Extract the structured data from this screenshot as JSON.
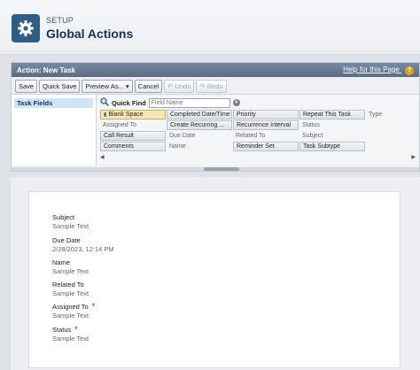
{
  "header": {
    "kicker": "SETUP",
    "title": "Global Actions",
    "icon": "gear-icon",
    "icon_bg": "#2f5d86"
  },
  "editor": {
    "title": "Action: New Task",
    "help_link": "Help for this Page",
    "help_icon": "question-icon",
    "toolbar": {
      "save": "Save",
      "quick_save": "Quick Save",
      "preview": "Preview As...",
      "cancel": "Cancel",
      "undo": "Undo",
      "redo": "Redo"
    },
    "sidebar": {
      "items": [
        "Task Fields"
      ]
    },
    "quick_find": {
      "label": "Quick Find",
      "placeholder": "Field Name"
    },
    "fields": [
      {
        "label": "Blank Space",
        "state": "selected"
      },
      {
        "label": "Completed Date/Time",
        "state": "available"
      },
      {
        "label": "Priority",
        "state": "available"
      },
      {
        "label": "Repeat This Task",
        "state": "available"
      },
      {
        "label": "Type",
        "state": "used"
      },
      {
        "label": "Assigned To",
        "state": "used"
      },
      {
        "label": "Create Recurring ...",
        "state": "available"
      },
      {
        "label": "Recurrence Interval",
        "state": "available"
      },
      {
        "label": "Status",
        "state": "used"
      },
      {
        "label": "",
        "state": "empty"
      },
      {
        "label": "Call Result",
        "state": "available"
      },
      {
        "label": "Due Date",
        "state": "used"
      },
      {
        "label": "Related To",
        "state": "used"
      },
      {
        "label": "Subject",
        "state": "used"
      },
      {
        "label": "",
        "state": "empty"
      },
      {
        "label": "Comments",
        "state": "available"
      },
      {
        "label": "Name",
        "state": "used"
      },
      {
        "label": "Reminder Set",
        "state": "available"
      },
      {
        "label": "Task Subtype",
        "state": "available"
      },
      {
        "label": "",
        "state": "empty"
      }
    ]
  },
  "layout": {
    "fields": [
      {
        "label": "Subject",
        "value": "Sample Text",
        "required": false
      },
      {
        "label": "Due Date",
        "value": "2/28/2023, 12:14 PM",
        "required": false
      },
      {
        "label": "Name",
        "value": "Sample Text",
        "required": false
      },
      {
        "label": "Related To",
        "value": "Sample Text",
        "required": false
      },
      {
        "label": "Assigned To",
        "value": "Sample Text",
        "required": true
      },
      {
        "label": "Status",
        "value": "Sample Text",
        "required": true
      }
    ],
    "required_color": "#d0021b"
  }
}
